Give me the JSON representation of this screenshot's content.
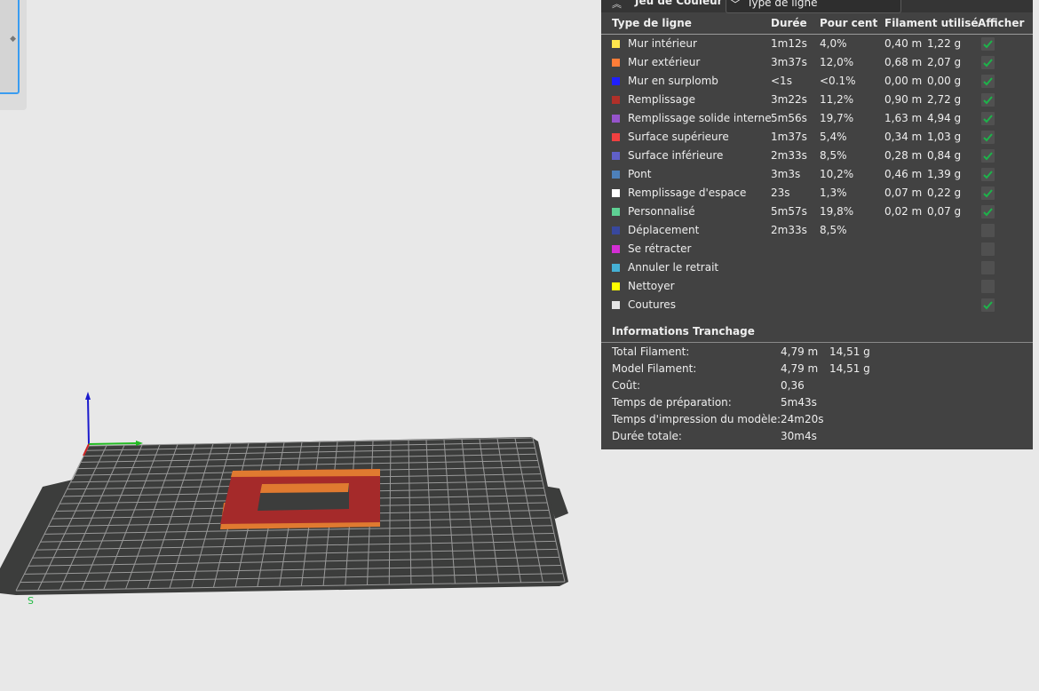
{
  "color_scheme": {
    "title": "Jeu de Couleur",
    "selected": "Type de ligne",
    "collapse_icon": "double-chevron-up-icon",
    "dropdown_icon": "chevron-down-icon"
  },
  "table": {
    "headers": [
      "Type de ligne",
      "Durée",
      "Pour cent",
      "Filament utilisé",
      "Afficher"
    ],
    "rows": [
      {
        "name": "Mur intérieur",
        "color": "#FFE64D",
        "time": "1m12s",
        "pct": "4,0%",
        "m": "0,40 m",
        "g": "1,22 g",
        "show": true
      },
      {
        "name": "Mur extérieur",
        "color": "#FF7D38",
        "time": "3m37s",
        "pct": "12,0%",
        "m": "0,68 m",
        "g": "2,07 g",
        "show": true
      },
      {
        "name": "Mur en surplomb",
        "color": "#1F1FFF",
        "time": "<1s",
        "pct": "<0.1%",
        "m": "0,00 m",
        "g": "0,00 g",
        "show": true
      },
      {
        "name": "Remplissage",
        "color": "#B03029",
        "time": "3m22s",
        "pct": "11,2%",
        "m": "0,90 m",
        "g": "2,72 g",
        "show": true
      },
      {
        "name": "Remplissage solide interne",
        "color": "#9654CC",
        "time": "5m56s",
        "pct": "19,7%",
        "m": "1,63 m",
        "g": "4,94 g",
        "show": true
      },
      {
        "name": "Surface supérieure",
        "color": "#F04040",
        "time": "1m37s",
        "pct": "5,4%",
        "m": "0,34 m",
        "g": "1,03 g",
        "show": true
      },
      {
        "name": "Surface inférieure",
        "color": "#6060C8",
        "time": "2m33s",
        "pct": "8,5%",
        "m": "0,28 m",
        "g": "0,84 g",
        "show": true
      },
      {
        "name": "Pont",
        "color": "#4D80BA",
        "time": "3m3s",
        "pct": "10,2%",
        "m": "0,46 m",
        "g": "1,39 g",
        "show": true
      },
      {
        "name": "Remplissage d'espace",
        "color": "#FFFFFF",
        "time": "23s",
        "pct": "1,3%",
        "m": "0,07 m",
        "g": "0,22 g",
        "show": true
      },
      {
        "name": "Personnalisé",
        "color": "#5ED194",
        "time": "5m57s",
        "pct": "19,8%",
        "m": "0,02 m",
        "g": "0,07 g",
        "show": true
      },
      {
        "name": "Déplacement",
        "color": "#38489E",
        "time": "2m33s",
        "pct": "8,5%",
        "m": "",
        "g": "",
        "show": false
      },
      {
        "name": "Se rétracter",
        "color": "#D42ED4",
        "time": "",
        "pct": "",
        "m": "",
        "g": "",
        "show": false
      },
      {
        "name": "Annuler le retrait",
        "color": "#45B0D4",
        "time": "",
        "pct": "",
        "m": "",
        "g": "",
        "show": false
      },
      {
        "name": "Nettoyer",
        "color": "#FFFF00",
        "time": "",
        "pct": "",
        "m": "",
        "g": "",
        "show": false
      },
      {
        "name": "Coutures",
        "color": "#E6E6E6",
        "time": "",
        "pct": "",
        "m": "",
        "g": "",
        "show": true
      }
    ]
  },
  "slice_info": {
    "title": "Informations Tranchage",
    "rows": [
      {
        "label": "Total Filament:",
        "v1": "4,79 m",
        "v2": "14,51 g"
      },
      {
        "label": "Model Filament:",
        "v1": "4,79 m",
        "v2": "14,51 g"
      },
      {
        "label": "Coût:",
        "v1": "0,36",
        "v2": ""
      },
      {
        "label": "Temps de préparation:",
        "v1": "5m43s",
        "v2": ""
      },
      {
        "label": "Temps d'impression du modèle:",
        "v1": "24m20s",
        "v2": ""
      },
      {
        "label": "Durée totale:",
        "v1": "30m4s",
        "v2": ""
      }
    ]
  },
  "colors": {
    "check": "#1db34a",
    "accent": "#3a9cf0",
    "bed": "#3c3d3c",
    "model_top": "#a52a2a",
    "model_wall": "#e07a30"
  }
}
